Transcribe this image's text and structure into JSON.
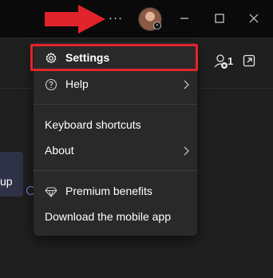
{
  "titlebar": {
    "more_label": "···",
    "avatar_icon": "user-avatar",
    "minimize_icon": "minimize-icon",
    "maximize_icon": "maximize-icon",
    "close_icon": "close-icon",
    "annotation_color": "#e1242b"
  },
  "header": {
    "participants_count": "1",
    "participants_icon": "people-add-icon",
    "popout_icon": "popout-icon"
  },
  "chat": {
    "bubble_text": "up",
    "bubble_color": "#2f3247"
  },
  "menu": {
    "items": [
      {
        "label": "Settings",
        "icon": "gear-icon",
        "highlighted": true
      },
      {
        "label": "Help",
        "icon": "question-circle-icon",
        "submenu": true
      },
      {
        "label": "Keyboard shortcuts"
      },
      {
        "label": "About",
        "submenu": true
      },
      {
        "label": "Premium benefits",
        "icon": "diamond-icon"
      },
      {
        "label": "Download the mobile app"
      }
    ]
  },
  "colors": {
    "titlebar_bg": "#0a0a0a",
    "content_bg": "#1f1f1f",
    "menu_bg": "#292929",
    "highlight_border": "#e1242b",
    "accent": "#7f85f5"
  }
}
